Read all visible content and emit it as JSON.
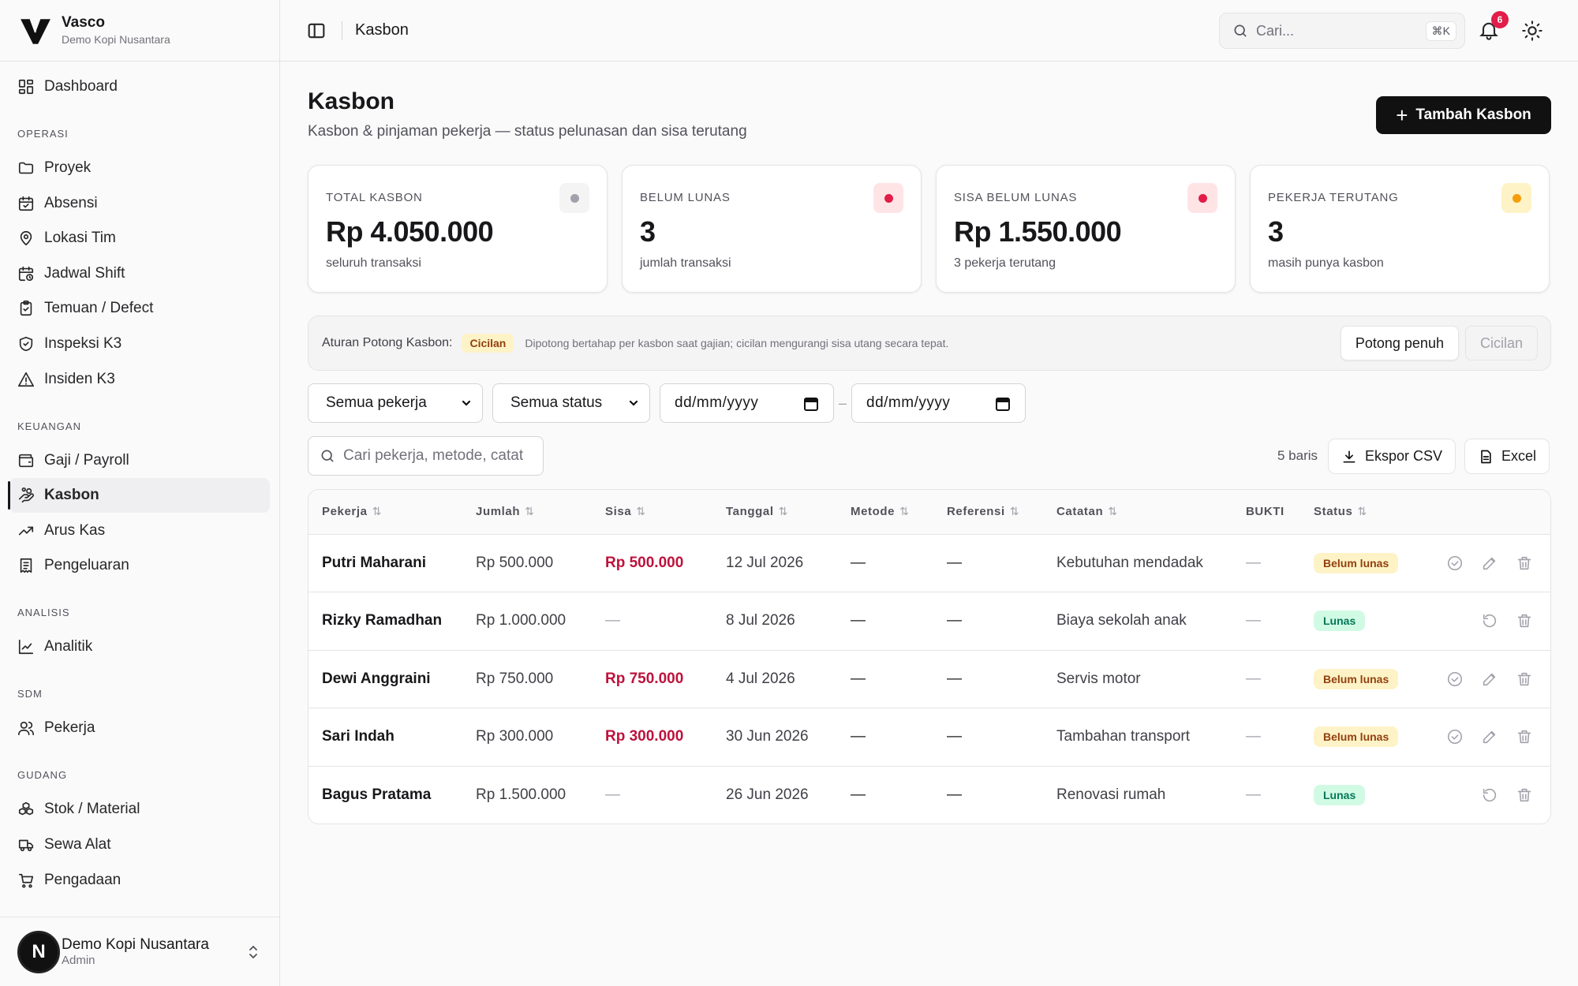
{
  "brand": {
    "name": "Vasco",
    "org": "Demo Kopi Nusantara"
  },
  "sidebar": {
    "dashboard": "Dashboard",
    "sections": [
      {
        "title": "OPERASI",
        "items": [
          "Proyek",
          "Absensi",
          "Lokasi Tim",
          "Jadwal Shift",
          "Temuan / Defect",
          "Inspeksi K3",
          "Insiden K3"
        ]
      },
      {
        "title": "KEUANGAN",
        "items": [
          "Gaji / Payroll",
          "Kasbon",
          "Arus Kas",
          "Pengeluaran"
        ]
      },
      {
        "title": "ANALISIS",
        "items": [
          "Analitik"
        ]
      },
      {
        "title": "SDM",
        "items": [
          "Pekerja"
        ]
      },
      {
        "title": "GUDANG",
        "items": [
          "Stok / Material",
          "Sewa Alat",
          "Pengadaan"
        ]
      }
    ],
    "active_item": "Kasbon"
  },
  "user": {
    "avatar": "N",
    "name": "Demo Kopi Nusantara",
    "role": "Admin"
  },
  "topbar": {
    "title": "Kasbon",
    "search_placeholder": "Cari...",
    "shortcut": "⌘K",
    "notifications": "6"
  },
  "page": {
    "title": "Kasbon",
    "subtitle": "Kasbon & pinjaman pekerja — status pelunasan dan sisa terutang",
    "add_button": "Tambah Kasbon"
  },
  "cards": [
    {
      "label": "TOTAL KASBON",
      "value": "Rp 4.050.000",
      "sub": "seluruh transaksi",
      "dot": "#a1a1aa",
      "dot_bg": "#f4f4f5"
    },
    {
      "label": "BELUM LUNAS",
      "value": "3",
      "sub": "jumlah transaksi",
      "dot": "#e11d48",
      "dot_bg": "#ffe4e6"
    },
    {
      "label": "SISA BELUM LUNAS",
      "value": "Rp 1.550.000",
      "sub": "3 pekerja terutang",
      "dot": "#e11d48",
      "dot_bg": "#ffe4e6"
    },
    {
      "label": "PEKERJA TERUTANG",
      "value": "3",
      "sub": "masih punya kasbon",
      "dot": "#f59e0b",
      "dot_bg": "#fef3c7"
    }
  ],
  "rule": {
    "label": "Aturan Potong Kasbon:",
    "badge": "Cicilan",
    "desc": "Dipotong bertahap per kasbon saat gajian; cicilan mengurangi sisa utang secara tepat.",
    "opt_full": "Potong penuh",
    "opt_installment": "Cicilan"
  },
  "filters": {
    "worker": "Semua pekerja",
    "status": "Semua status",
    "date_from": "dd/mm/yyyy",
    "date_sep": "–",
    "date_to": "dd/mm/yyyy"
  },
  "table_tools": {
    "search_placeholder": "Cari pekerja, metode, catat",
    "row_count": "5 baris",
    "export_csv": "Ekspor CSV",
    "export_excel": "Excel"
  },
  "table": {
    "columns": [
      "Pekerja",
      "Jumlah",
      "Sisa",
      "Tanggal",
      "Metode",
      "Referensi",
      "Catatan",
      "BUKTI",
      "Status"
    ],
    "rows": [
      {
        "pekerja": "Putri Maharani",
        "jumlah": "Rp 500.000",
        "sisa": "Rp 500.000",
        "tanggal": "12 Jul 2026",
        "metode": "—",
        "referensi": "—",
        "catatan": "Kebutuhan mendadak",
        "bukti": "—",
        "status": "Belum lunas"
      },
      {
        "pekerja": "Rizky Ramadhan",
        "jumlah": "Rp 1.000.000",
        "sisa": "—",
        "tanggal": "8 Jul 2026",
        "metode": "—",
        "referensi": "—",
        "catatan": "Biaya sekolah anak",
        "bukti": "—",
        "status": "Lunas"
      },
      {
        "pekerja": "Dewi Anggraini",
        "jumlah": "Rp 750.000",
        "sisa": "Rp 750.000",
        "tanggal": "4 Jul 2026",
        "metode": "—",
        "referensi": "—",
        "catatan": "Servis motor",
        "bukti": "—",
        "status": "Belum lunas"
      },
      {
        "pekerja": "Sari Indah",
        "jumlah": "Rp 300.000",
        "sisa": "Rp 300.000",
        "tanggal": "30 Jun 2026",
        "metode": "—",
        "referensi": "—",
        "catatan": "Tambahan transport",
        "bukti": "—",
        "status": "Belum lunas"
      },
      {
        "pekerja": "Bagus Pratama",
        "jumlah": "Rp 1.500.000",
        "sisa": "—",
        "tanggal": "26 Jun 2026",
        "metode": "—",
        "referensi": "—",
        "catatan": "Renovasi rumah",
        "bukti": "—",
        "status": "Lunas"
      }
    ]
  },
  "colors": {
    "accent": "#111111",
    "danger": "#be123c",
    "paid": "#047857",
    "unpaid": "#92400e"
  }
}
